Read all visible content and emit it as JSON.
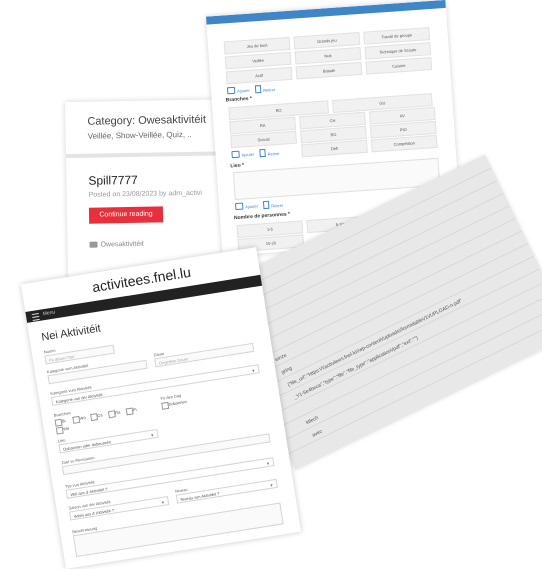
{
  "blog": {
    "category": "Category: Owesaktivitéit",
    "tags": "Veillée, Show-Veillée, Quiz, ..",
    "post_title": "Spill7777",
    "post_meta": "Posted on 23/08/2023 by adm_activi",
    "continue_label": "Continue reading",
    "category_link": "Owesaktivitéit"
  },
  "options": {
    "row1": [
      "Jeu de bout",
      "Grands jeu",
      "Travail de groupe"
    ],
    "row2": [
      "Veillée",
      "Nuit",
      "Technique de Scoute"
    ],
    "row3": [
      "Actif",
      "Balade",
      "Cuisine"
    ],
    "add_label": "Ajouter",
    "link_label": "Retirer",
    "branches_label": "Branches *",
    "branches": [
      "BO",
      "GU",
      "RA",
      "CH",
      "AV",
      "TOUS"
    ],
    "sub_chips": [
      "Scouts",
      "BO",
      "PIO",
      "Défi",
      "Compétition"
    ],
    "lieu_label": "Lieu *",
    "personnes_label": "Nombre de personnes *",
    "personnes": [
      "1-5",
      "5-10",
      "10-20"
    ]
  },
  "sheet": {
    "lines": [
      "einze",
      "gring",
      "{\"file_url\":\"https:\\/\\/activitees.fnel.lu\\/wp-content\\/uploads\\/formidable\\/1\\/UPLOAD-n.pdf\"",
      "_Y1-5e4beca\",\"type\":\"file\",\"file_type\":\"application\\/pdf\",\"ext\":\"\"}",
      "ktlech",
      "avec"
    ]
  },
  "app": {
    "site_title": "activitees.fnel.lu",
    "menu_label": "Menu",
    "form_title": "Nei Aktivitéit",
    "name_label": "Numm",
    "name_placeholder": "Fir dësen Titel",
    "kategorie_label": "Kategorie vum Aktivitéit",
    "kategorie_placeholder": "Kategorie vun der Aktivitéit",
    "dauer_label": "Dauer",
    "dauer_placeholder": "Ongeféier Dauer",
    "branchen_label": "Branchen",
    "branchen_opts": [
      "Bi",
      "Wö",
      "Ca",
      "Ra",
      "Pi",
      "Wö"
    ],
    "lieu_label": "Lieu",
    "lieu_placeholder": "Dobannen oder dobaussen",
    "extra_label": "Fir den Dag",
    "extra_opt": "Dobannen",
    "personnen_label": "Zuel vu Persounen",
    "typ_label": "Typ vun Aktivitéit",
    "typ_value": "Wéi ass d' Aktivitéit ?",
    "saison_label": "Saison vun der Aktivitéit",
    "saison_value": "Wéini ass d' Aktivitéit ?",
    "niveau_label": "Niveau",
    "niveau_value": "Niveau vun Aktivitéit ?",
    "bottom_label": "Beschreiwung"
  }
}
